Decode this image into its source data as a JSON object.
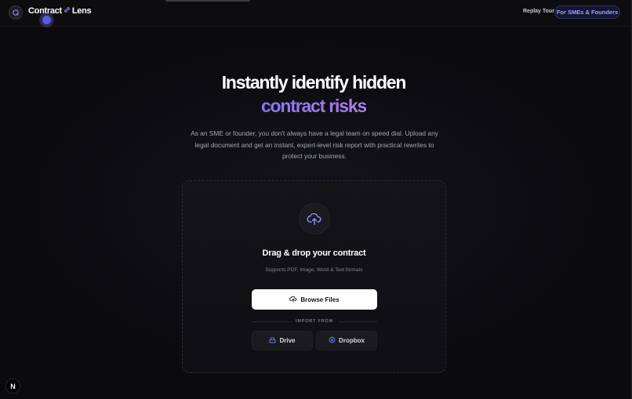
{
  "header": {
    "brand_left": "Contract",
    "brand_right": "Lens",
    "replay_label": "Replay Tour",
    "audience_pill": "For SMEs & Founders"
  },
  "hero": {
    "title_line1": "Instantly identify hidden",
    "title_line2": "contract risks",
    "description": "As an SME or founder, you don't always have a legal team on speed dial. Upload any legal document and get an instant, expert-level risk report with practical rewrites to protect your business."
  },
  "upload": {
    "title": "Drag & drop your contract",
    "subtitle": "Supports PDF, Image, Word & Text formats",
    "browse_label": "Browse Files",
    "import_label": "IMPORT FROM",
    "drive_label": "Drive",
    "dropbox_label": "Dropbox"
  },
  "footer": {
    "badge": "N"
  },
  "colors": {
    "accent": "#9b7cf6",
    "pill_text": "#9aa4ff",
    "background": "#0b0b0e"
  },
  "icons": [
    "logo-icon",
    "link-icon",
    "upload-cloud-icon",
    "cloud-upload-icon",
    "drive-icon",
    "dropbox-icon"
  ]
}
